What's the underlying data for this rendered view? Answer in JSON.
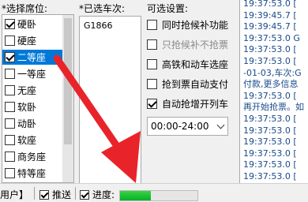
{
  "seats": {
    "label": "*选择席位:",
    "items": [
      {
        "label": "硬卧",
        "checked": true,
        "selected": false
      },
      {
        "label": "硬座",
        "checked": false,
        "selected": false
      },
      {
        "label": "二等座",
        "checked": true,
        "selected": true
      },
      {
        "label": "一等座",
        "checked": false,
        "selected": false
      },
      {
        "label": "无座",
        "checked": false,
        "selected": false
      },
      {
        "label": "软卧",
        "checked": false,
        "selected": false
      },
      {
        "label": "动卧",
        "checked": false,
        "selected": false
      },
      {
        "label": "软座",
        "checked": false,
        "selected": false
      },
      {
        "label": "商务座",
        "checked": false,
        "selected": false
      },
      {
        "label": "特等座",
        "checked": false,
        "selected": false
      }
    ]
  },
  "trains": {
    "label": "*已选车次:",
    "items": [
      "G1866"
    ]
  },
  "settings": {
    "label": "可选设置:",
    "options": [
      {
        "label": "同时抢候补功能",
        "checked": false,
        "disabled": false
      },
      {
        "label": "只抢候补不抢票",
        "checked": false,
        "disabled": true
      },
      {
        "label": "高铁和动车选座",
        "checked": false,
        "disabled": false
      },
      {
        "label": "抢到票自动支付",
        "checked": false,
        "disabled": false
      },
      {
        "label": "自动抢增开列车",
        "checked": true,
        "disabled": false
      }
    ],
    "time_range": "00:00-24:00"
  },
  "log": {
    "lines": [
      "19:37:53.0 [",
      "19:39:45.7 [",
      "19:39:45.7 [",
      "19:37:53.0 G",
      "19:37:53.0 [",
      "19:37:53.0 [",
      "-01-03,车次:G",
      "付款,更多信息",
      "19:37:53.0 [",
      "再开始抢票。如",
      "19:37:53.0 [",
      "19:37:53.0 [",
      "19:37:53.0 [",
      "19:37:53.0 [",
      "19:37:53.0 [",
      "19:37:53.0 ["
    ]
  },
  "status": {
    "user_label": "用户】",
    "push_label": "推送",
    "progress_label": "进度:",
    "progress_percent": 40
  },
  "colors": {
    "selection": "#0078d7",
    "progress": "#06b025",
    "arrow": "#e8242a"
  }
}
